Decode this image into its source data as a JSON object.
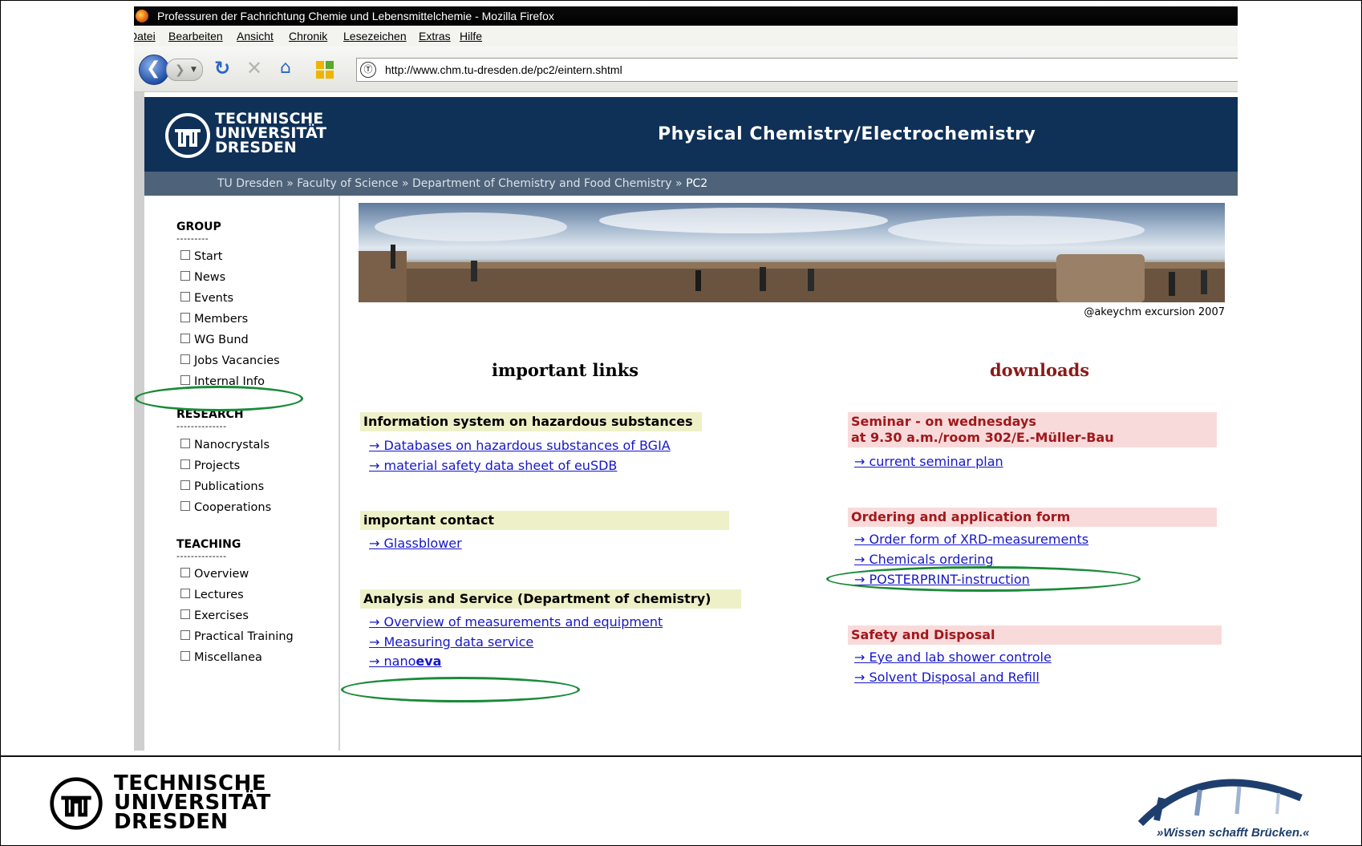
{
  "window": {
    "title": "Professuren der Fachrichtung Chemie und Lebensmittelchemie - Mozilla Firefox",
    "menu": [
      "Datei",
      "Bearbeiten",
      "Ansicht",
      "Chronik",
      "Lesezeichen",
      "Extras",
      "Hilfe"
    ],
    "url": "http://www.chm.tu-dresden.de/pc2/eintern.shtml"
  },
  "header": {
    "logo_lines": [
      "TECHNISCHE",
      "UNIVERSITÄT",
      "DRESDEN"
    ],
    "title": "Physical Chemistry/Electrochemistry"
  },
  "breadcrumb": {
    "items": [
      "TU Dresden",
      "Faculty of Science",
      "Department of Chemistry and Food Chemistry"
    ],
    "separator": "»",
    "current": "PC2"
  },
  "sidebar": {
    "sections": [
      {
        "title": "GROUP",
        "dashes": "---------",
        "items": [
          "Start",
          "News",
          "Events",
          "Members",
          "WG Bund",
          "Jobs Vacancies",
          "Internal Info"
        ]
      },
      {
        "title": "RESEARCH",
        "dashes": "--------------",
        "items": [
          "Nanocrystals",
          "Projects",
          "Publications",
          "Cooperations"
        ]
      },
      {
        "title": "TEACHING",
        "dashes": "--------------",
        "items": [
          "Overview",
          "Lectures",
          "Exercises",
          "Practical Training",
          "Miscellanea"
        ]
      }
    ]
  },
  "banner": {
    "credit": "@akeychm excursion 2007"
  },
  "important_links": {
    "heading": "important links",
    "groups": [
      {
        "title": "Information system on hazardous substances",
        "links": [
          "→ Databases on hazardous substances of BGIA",
          "→ material safety data sheet of euSDB"
        ]
      },
      {
        "title": "important contact",
        "links": [
          "→ Glassblower"
        ]
      },
      {
        "title": "Analysis and Service (Department of chemistry)",
        "links": [
          "→ Overview of measurements and equipment",
          "→ Measuring data service"
        ],
        "last_link_prefix": "→ nano",
        "last_link_bold": "eva"
      }
    ]
  },
  "downloads": {
    "heading": "downloads",
    "groups": [
      {
        "title_lines": [
          "Seminar - on wednesdays",
          "at 9.30 a.m./room 302/E.-Müller-Bau"
        ],
        "links": [
          "→ current seminar plan"
        ]
      },
      {
        "title": "Ordering and application form",
        "links": [
          "→ Order form of XRD-measurements",
          "→ Chemicals ordering",
          "→ POSTERPRINT-instruction"
        ]
      },
      {
        "title": "Safety and Disposal",
        "links": [
          "→ Eye and lab shower controle",
          "→ Solvent Disposal and Refill"
        ]
      }
    ]
  },
  "footer": {
    "tu_logo_lines": [
      "TECHNISCHE",
      "UNIVERSITÄT",
      "DRESDEN"
    ],
    "slogan": "»Wissen schafft Brücken.«"
  },
  "colors": {
    "header_bg": "#0f3057",
    "breadcrumb_bg": "#4e6379",
    "link": "#1717c9",
    "highlight_ellipse": "#1a8a3a",
    "download_title": "#a0181c"
  }
}
